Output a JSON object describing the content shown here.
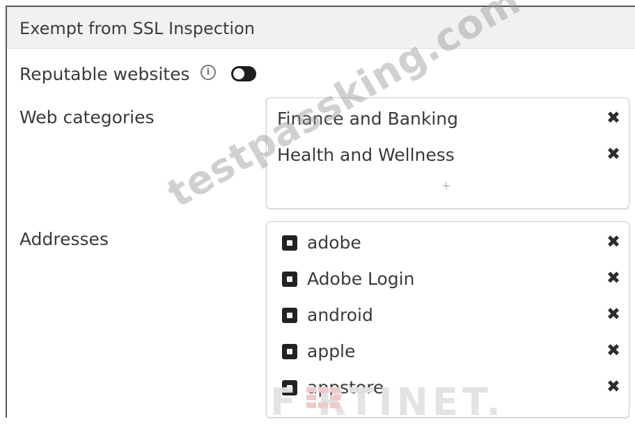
{
  "section": {
    "title": "Exempt from SSL Inspection"
  },
  "reputable": {
    "label": "Reputable websites",
    "info_icon": "info-circle-icon",
    "toggle_state": "off"
  },
  "web_categories": {
    "label": "Web categories",
    "items": [
      {
        "label": "Finance and Banking"
      },
      {
        "label": "Health and Wellness"
      }
    ],
    "add_symbol": "+"
  },
  "addresses": {
    "label": "Addresses",
    "item_icon": "address-object-icon",
    "items": [
      {
        "label": "adobe"
      },
      {
        "label": "Adobe Login"
      },
      {
        "label": "android"
      },
      {
        "label": "apple"
      },
      {
        "label": "appstore"
      }
    ]
  },
  "remove_symbol": "✖",
  "watermark": "testpassking.com",
  "brand": "F  RTINET."
}
